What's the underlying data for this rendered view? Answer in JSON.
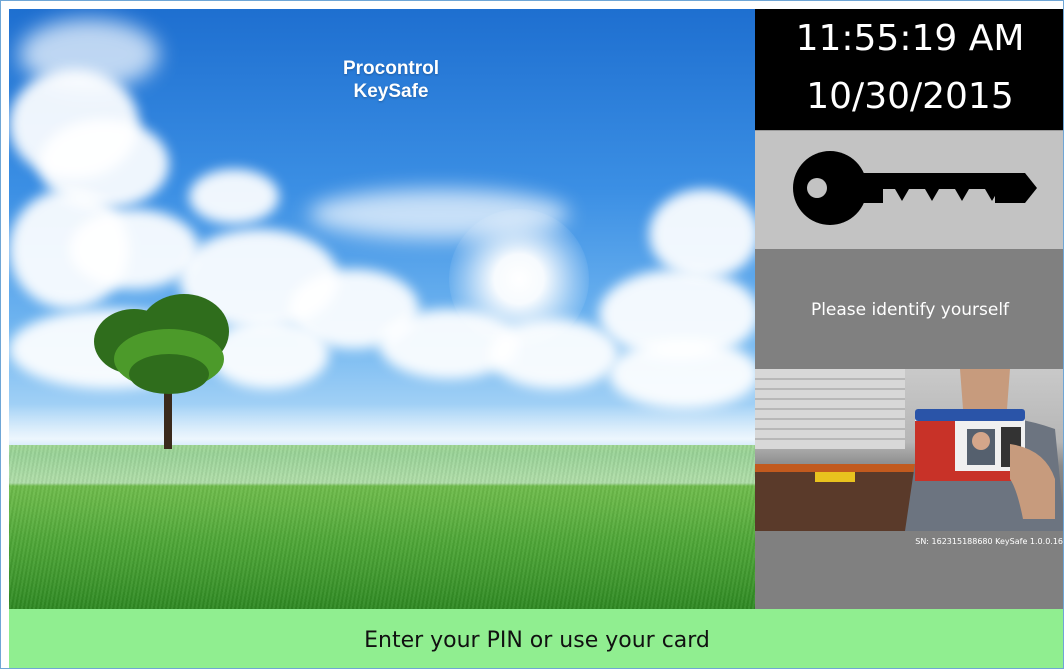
{
  "brand": {
    "line1": "Procontrol",
    "line2": "KeySafe"
  },
  "clock": {
    "time": "11:55:19 AM",
    "date": "10/30/2015"
  },
  "key_panel": {
    "icon": "key-icon"
  },
  "identify": {
    "prompt": "Please identify yourself",
    "photo": "person-holding-id-card",
    "serial": "SN: 162315188680 KeySafe 1.0.0.16"
  },
  "status": {
    "message": "Enter your PIN or use your card"
  },
  "colors": {
    "status_bar": "#90ee90",
    "clock_bg": "#000000",
    "key_panel_bg": "#c3c3c3",
    "id_panel_bg": "#808080"
  }
}
